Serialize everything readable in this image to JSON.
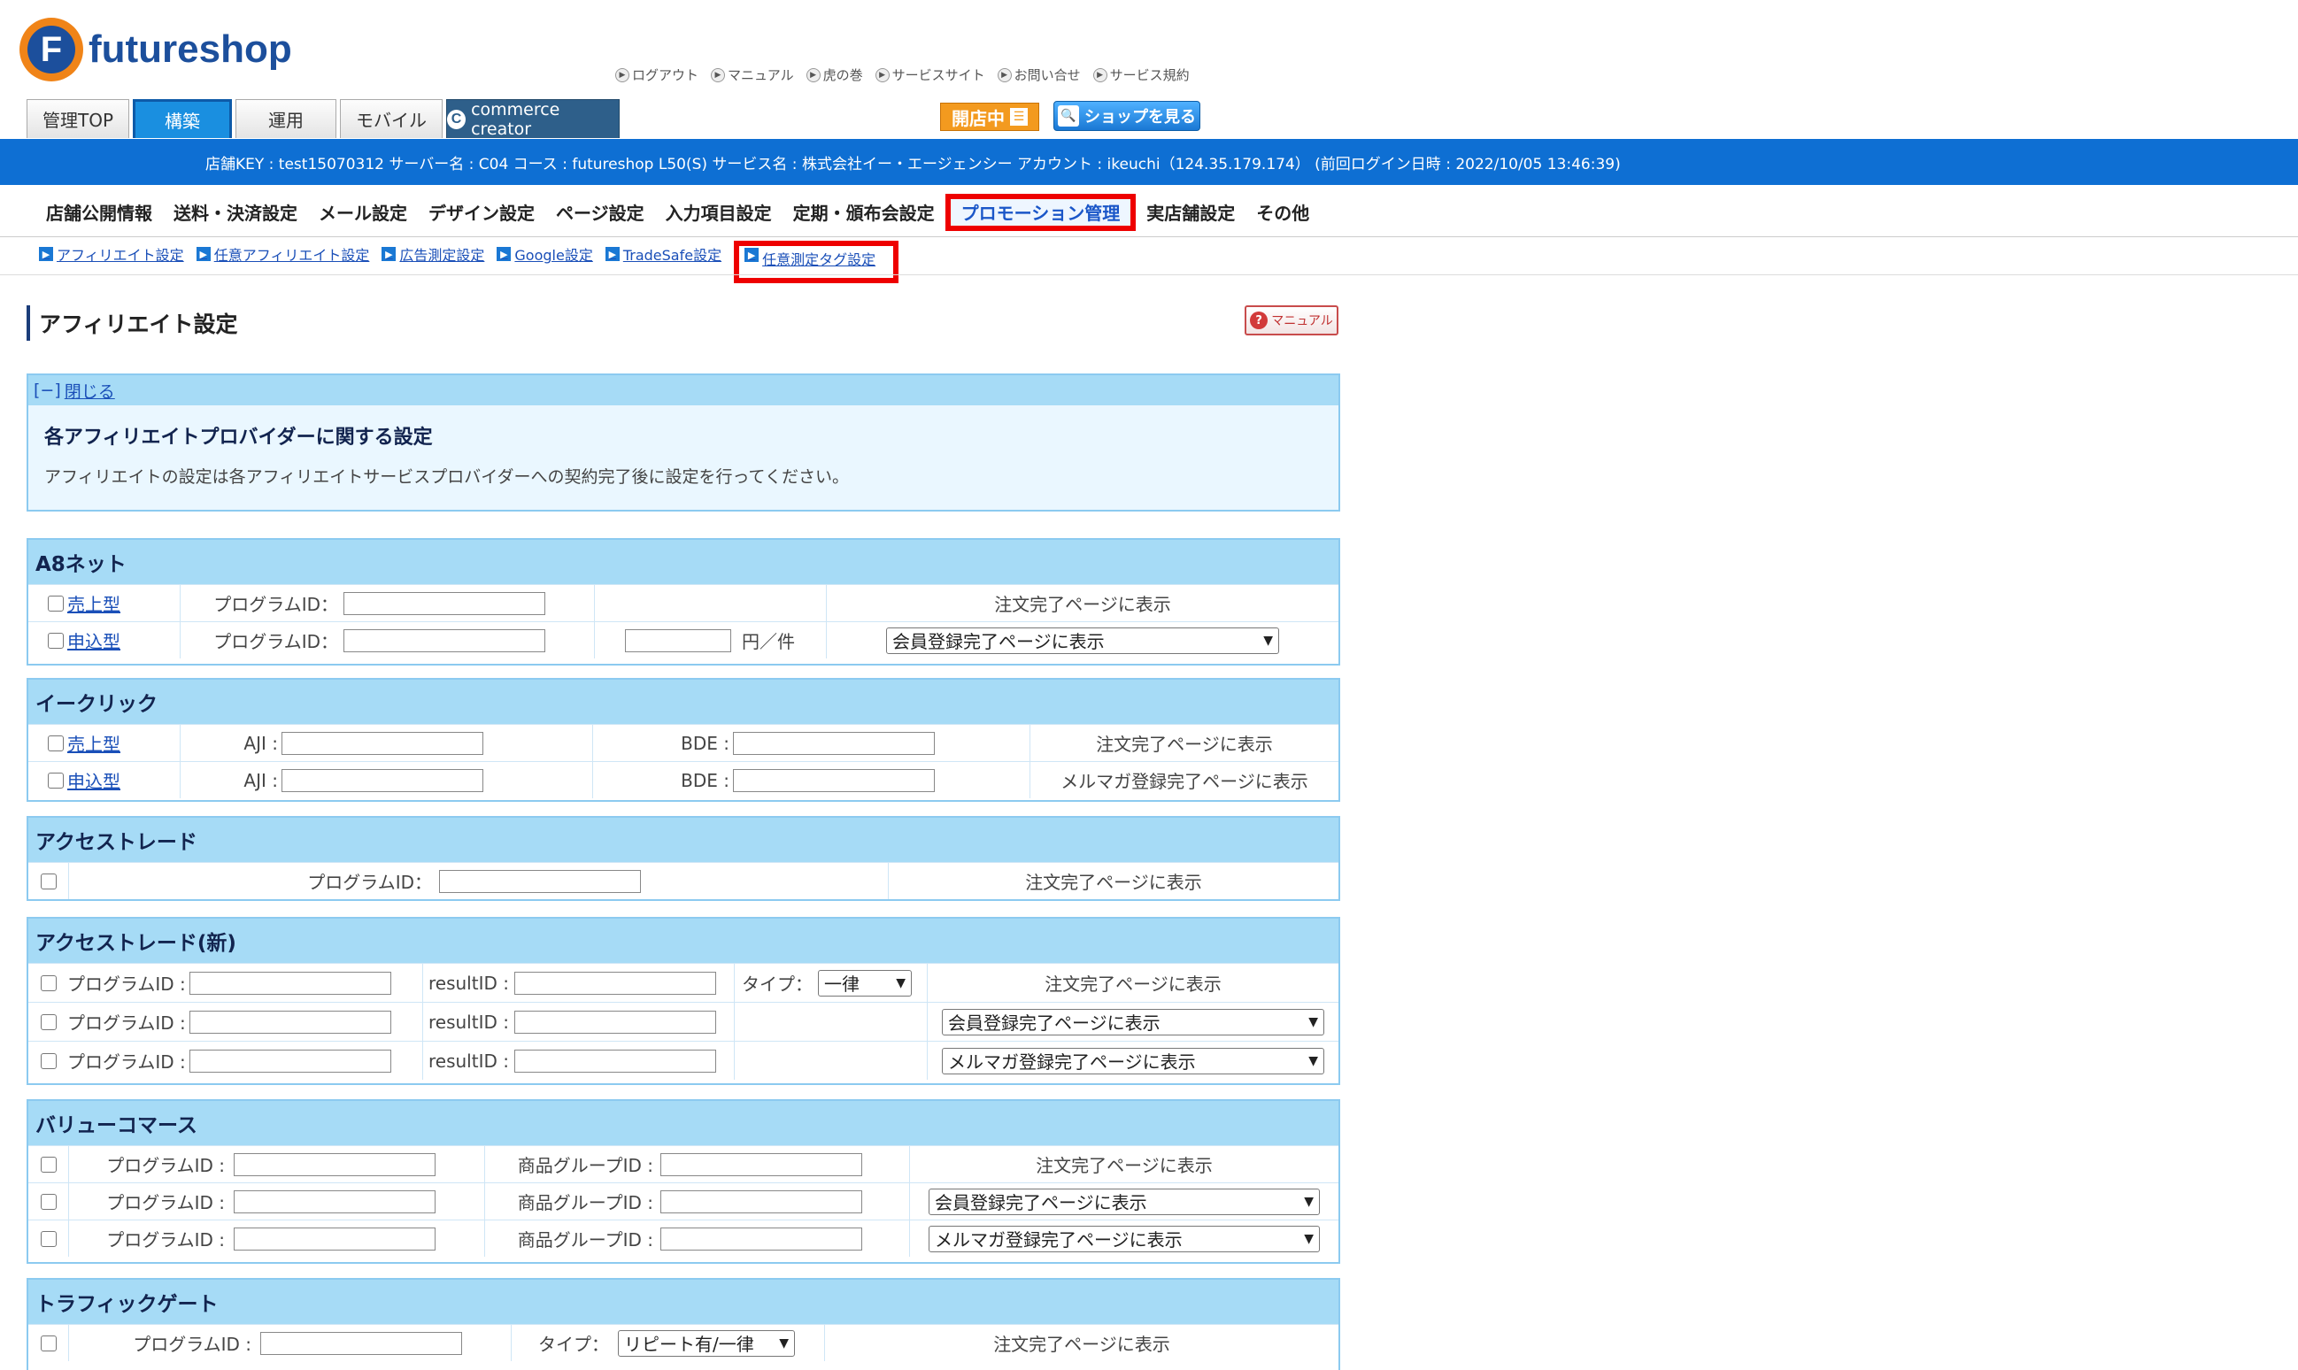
{
  "brand": {
    "name": "futureshop",
    "mark": "F"
  },
  "toplinks": [
    "ログアウト",
    "マニュアル",
    "虎の巻",
    "サービスサイト",
    "お問い合せ",
    "サービス規約"
  ],
  "tabs": {
    "t0": "管理TOP",
    "t1": "構築",
    "t2": "運用",
    "t3": "モバイル",
    "t4": "commerce creator"
  },
  "buttons": {
    "open": "開店中",
    "shop": "ショップを見る",
    "manual": "マニュアル"
  },
  "infobar": "店舗KEY : test15070312 サーバー名 : C04 コース : futureshop L50(S) サービス名 : 株式会社イー・エージェンシー アカウント : ikeuchi（124.35.179.174） (前回ログイン日時 : 2022/10/05 13:46:39)",
  "mainnav": [
    "店舗公開情報",
    "送料・決済設定",
    "メール設定",
    "デザイン設定",
    "ページ設定",
    "入力項目設定",
    "定期・頒布会設定",
    "プロモーション管理",
    "実店舗設定",
    "その他"
  ],
  "subnav": [
    "アフィリエイト設定",
    "任意アフィリエイト設定",
    "広告測定設定",
    "Google設定",
    "TradeSafe設定",
    "任意測定タグ設定"
  ],
  "page_title": "アフィリエイト設定",
  "notice": {
    "toggle": "[−]",
    "close": "閉じる",
    "title": "各アフィリエイトプロバイダーに関する設定",
    "text": "アフィリエイトの設定は各アフィリエイトサービスプロバイダーへの契約完了後に設定を行ってください。"
  },
  "common": {
    "program_id": "プログラムID：",
    "program_id_b": "プログラムID :",
    "result_id": "resultID :",
    "type": "タイプ：",
    "type_b": "タイプ：",
    "group_id": "商品グループID :",
    "aji": "AJI :",
    "bde": "BDE :",
    "sales": "売上型",
    "apply": "申込型",
    "per": "円／件",
    "order_done": "注文完了ページに表示",
    "member_done": "会員登録完了ページに表示",
    "mail_done": "メルマガ登録完了ページに表示",
    "ichiritsu": "一律",
    "repeat": "リピート有/一律"
  },
  "sections": {
    "a8": "A8ネット",
    "eclick": "イークリック",
    "at": "アクセストレード",
    "atnew": "アクセストレード(新)",
    "vc": "バリューコマース",
    "tg": "トラフィックゲート"
  }
}
